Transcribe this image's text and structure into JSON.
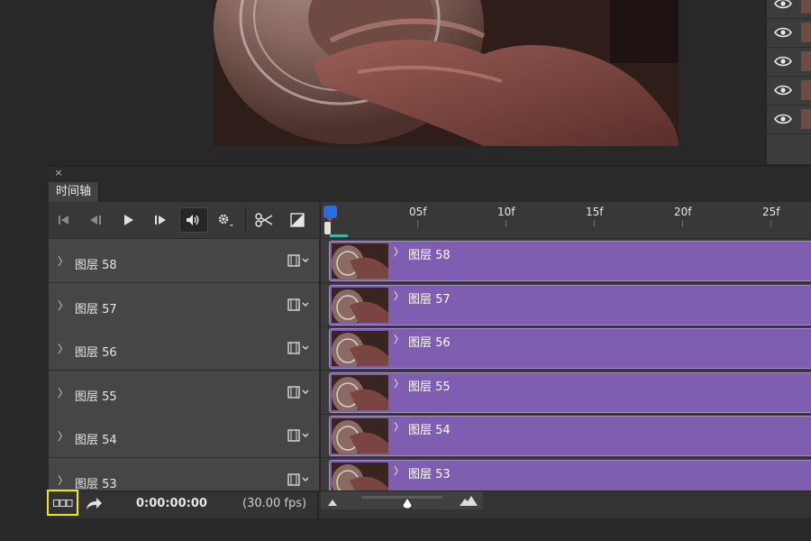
{
  "panel": {
    "tab_label": "时间轴",
    "close_glyph": "×"
  },
  "ruler": {
    "labels": [
      "05f",
      "10f",
      "15f",
      "20f",
      "25f"
    ]
  },
  "layers": [
    {
      "name": "图层 58"
    },
    {
      "name": "图层 57"
    },
    {
      "name": "图层 56"
    },
    {
      "name": "图层 55"
    },
    {
      "name": "图层 54"
    },
    {
      "name": "图层 53"
    }
  ],
  "footer": {
    "timecode": "0:00:00:00",
    "fps": "(30.00 fps)"
  },
  "colors": {
    "clip": "#7f5db0",
    "highlight": "#f1e51b",
    "playhead": "#2d6cdf"
  },
  "icons": {
    "controls": [
      "go-to-first-frame-icon",
      "previous-frame-icon",
      "play-icon",
      "next-frame-icon",
      "audio-icon",
      "settings-gear-icon",
      "split-scissors-icon",
      "transition-icon"
    ],
    "track": [
      "expand-chevron-icon",
      "film-strip-icon"
    ],
    "footer": [
      "convert-to-frame-animation-icon",
      "render-video-icon",
      "zoom-out-mountain-icon",
      "zoom-in-mountain-icon"
    ],
    "layers_panel": [
      "visibility-eye-icon"
    ]
  }
}
